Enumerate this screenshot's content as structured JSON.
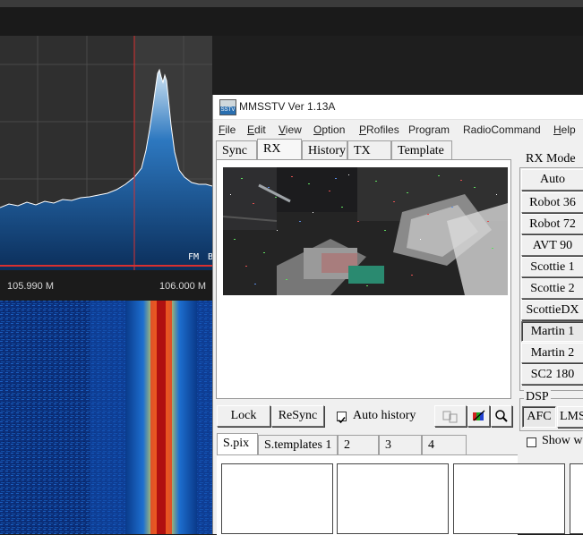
{
  "sdr": {
    "freq_left": "105.990 M",
    "freq_right": "106.000 M",
    "mode_label": "FM",
    "mode_suffix": "B"
  },
  "window": {
    "title": "MMSSTV Ver 1.13A",
    "icon_text": "SSTV"
  },
  "menu": [
    {
      "u": "F",
      "rest": "ile"
    },
    {
      "u": "E",
      "rest": "dit"
    },
    {
      "u": "V",
      "rest": "iew"
    },
    {
      "u": "O",
      "rest": "ption"
    },
    {
      "u": "P",
      "rest": "Rofiles"
    },
    {
      "u": "",
      "rest": "Program"
    },
    {
      "u": "",
      "rest": "RadioCommand"
    },
    {
      "u": "H",
      "rest": "elp"
    }
  ],
  "tabs": [
    "Sync",
    "RX",
    "History",
    "TX",
    "Template"
  ],
  "rx_controls": {
    "lock": "Lock",
    "resync": "ReSync",
    "auto_history": "Auto history",
    "auto_history_checked": true
  },
  "bottom_tabs": [
    "S.pix",
    "S.templates 1",
    "2",
    "3",
    "4"
  ],
  "rx_mode": {
    "label": "RX Mode",
    "modes": [
      "Auto",
      "Robot 36",
      "Robot 72",
      "AVT 90",
      "Scottie 1",
      "Scottie 2",
      "ScottieDX",
      "Martin 1",
      "Martin 2",
      "SC2 180"
    ],
    "selected": "Martin 1"
  },
  "dsp": {
    "label": "DSP",
    "afc": "AFC",
    "lms": "LMS",
    "show": "Show w"
  }
}
